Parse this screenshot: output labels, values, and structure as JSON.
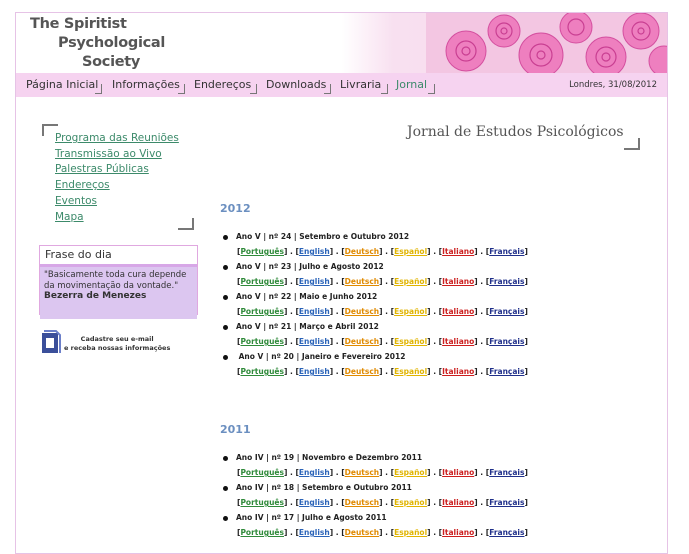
{
  "header": {
    "logo_lines": [
      "The Spiritist",
      "Psychological",
      "Society"
    ]
  },
  "nav": {
    "items": [
      "Página Inicial",
      "Informações",
      "Endereços",
      "Downloads",
      "Livraria",
      "Jornal"
    ],
    "date": "Londres, 31/08/2012"
  },
  "sidebar": {
    "links": [
      "Programa das Reuniões",
      "Transmissão ao Vivo",
      "Palestras Públicas",
      "Endereços",
      "Eventos",
      "Mapa"
    ],
    "frase": {
      "title": "Frase do dia",
      "quote": "\"Basicamente toda cura depende da movimentação da vontade.\"",
      "author": "Bezerra de Menezes"
    },
    "cadastre": [
      "Cadastre seu e-mail",
      "e receba nossas informações"
    ]
  },
  "main": {
    "title": "Jornal de Estudos Psicológicos",
    "languages": [
      "Português",
      "English",
      "Deutsch",
      "Español",
      "Italiano",
      "Français"
    ],
    "language_colors": [
      "#2f8a3a",
      "#2a63b8",
      "#e08a00",
      "#e0b400",
      "#cc1f1f",
      "#1f2f8a"
    ],
    "years": [
      {
        "year": "2012",
        "entries": [
          "Ano V | nº 24 | Setembro e Outubro 2012",
          "Ano V | nº 23 | Julho e Agosto 2012",
          "Ano V | nº 22 | Maio e Junho 2012",
          "Ano   V | nº 21 | Março e Abril 2012",
          " Ano V | nº 20  | Janeiro e Fevereiro 2012"
        ]
      },
      {
        "year": "2011",
        "entries": [
          "Ano IV | nº 19  | Novembro e Dezembro 2011",
          "Ano IV | nº 18  | Setembro e Outubro 2011",
          "Ano IV | nº 17  | Julho e Agosto 2011"
        ]
      }
    ]
  }
}
